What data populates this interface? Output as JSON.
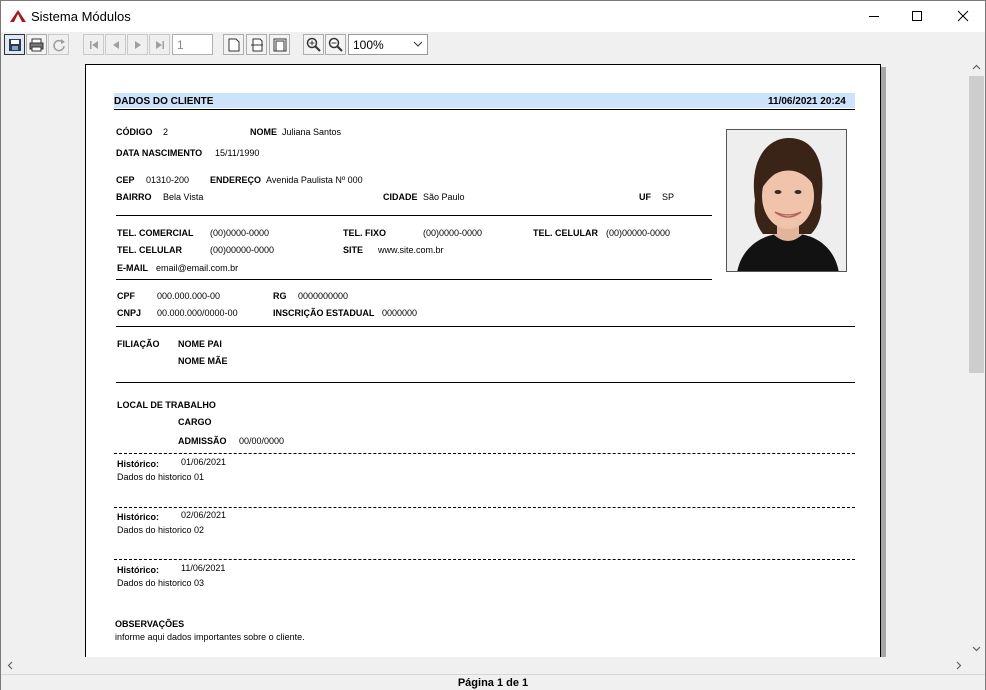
{
  "window": {
    "title": "Sistema Módulos"
  },
  "toolbar": {
    "page_number": "1",
    "zoom": "100%"
  },
  "report": {
    "header_title": "DADOS DO CLIENTE",
    "header_datetime": "11/06/2021 20:24",
    "codigo_label": "CÓDIGO",
    "codigo": "2",
    "nome_label": "NOME",
    "nome": "Juliana Santos",
    "nasc_label": "DATA NASCIMENTO",
    "nasc": "15/11/1990",
    "cep_label": "CEP",
    "cep": "01310-200",
    "endereco_label": "ENDEREÇO",
    "endereco": "Avenida Paulista Nº 000",
    "bairro_label": "BAIRRO",
    "bairro": "Bela Vista",
    "cidade_label": "CIDADE",
    "cidade": "São Paulo",
    "uf_label": "UF",
    "uf": "SP",
    "tel_com_label": "TEL. COMERCIAL",
    "tel_com": "(00)0000-0000",
    "tel_fixo_label": "TEL. FIXO",
    "tel_fixo": "(00)0000-0000",
    "tel_cel1_label": "TEL. CELULAR",
    "tel_cel1": "(00)00000-0000",
    "tel_cel2_label": "TEL. CELULAR",
    "tel_cel2": "(00)00000-0000",
    "site_label": "SITE",
    "site": "www.site.com.br",
    "email_label": "E-MAIL",
    "email": "email@email.com.br",
    "cpf_label": "CPF",
    "cpf": "000.000.000-00",
    "rg_label": "RG",
    "rg": "0000000000",
    "cnpj_label": "CNPJ",
    "cnpj": "00.000.000/0000-00",
    "ie_label": "INSCRIÇÃO ESTADUAL",
    "ie": "0000000",
    "filiacao_label": "FILIAÇÃO",
    "nome_pai_label": "NOME PAI",
    "nome_mae_label": "NOME MÃE",
    "trabalho_label": "LOCAL DE TRABALHO",
    "cargo_label": "CARGO",
    "admissao_label": "ADMISSÃO",
    "admissao": "00/00/0000",
    "historico": [
      {
        "label": "Histórico:",
        "date": "01/06/2021",
        "text": "Dados do historico 01"
      },
      {
        "label": "Histórico:",
        "date": "02/06/2021",
        "text": "Dados do historico 02"
      },
      {
        "label": "Histórico:",
        "date": "11/06/2021",
        "text": "Dados do historico 03"
      }
    ],
    "obs_label": "OBSERVAÇÕES",
    "obs": "informe aqui dados importantes sobre o cliente."
  },
  "status": {
    "page_info": "Página 1 de 1"
  }
}
